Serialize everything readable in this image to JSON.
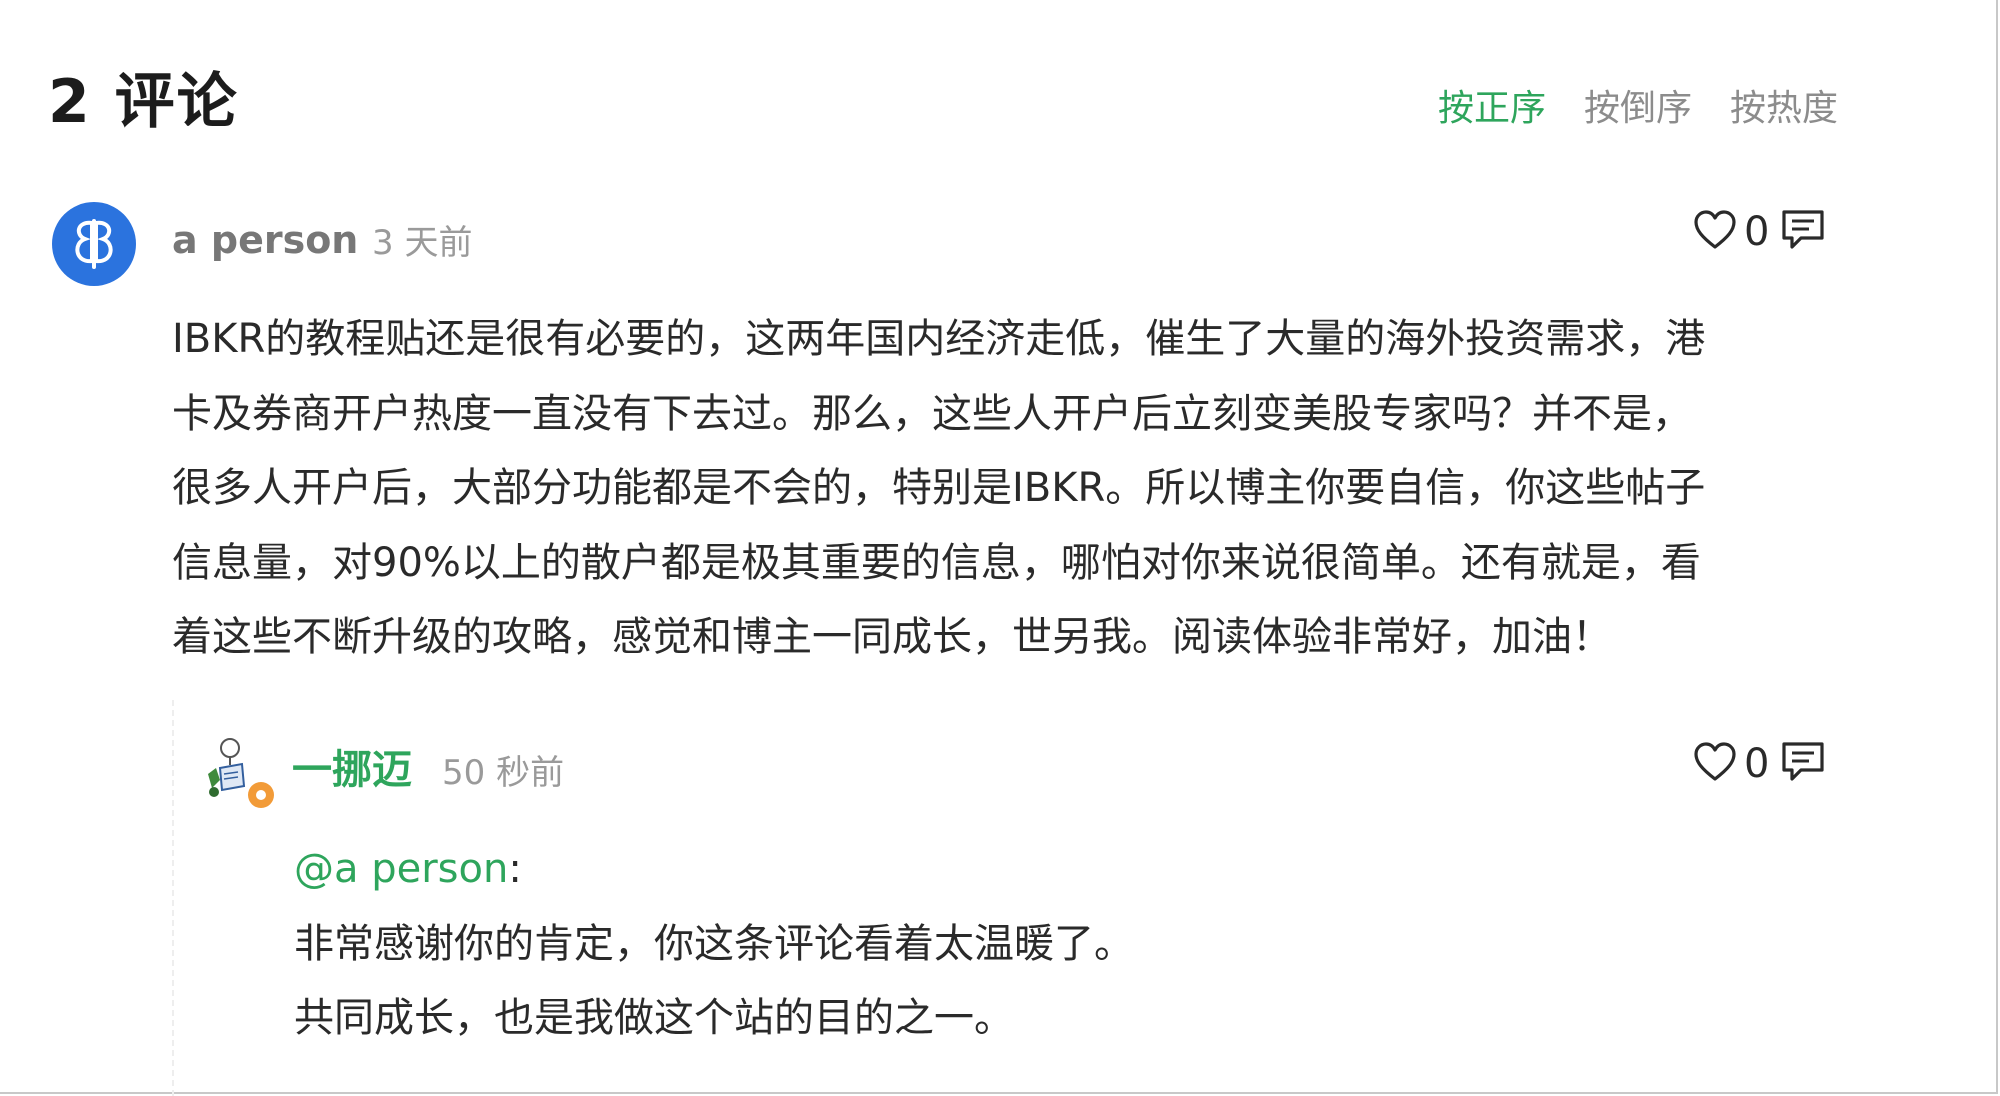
{
  "comments_header": {
    "title": "2 评论",
    "sort_options": [
      "按正序",
      "按倒序",
      "按热度"
    ],
    "active_sort": "按正序"
  },
  "comment": {
    "author": "a person",
    "time": "3 天前",
    "likes": "0",
    "avatar_icon": "butterfly-logo-icon",
    "body_lines": [
      "IBKR的教程贴还是很有必要的，这两年国内经济走低，催生了大量的海外投资需求，港",
      "卡及券商开户热度一直没有下去过。那么，这些人开户后立刻变美股专家吗？并不是，",
      "很多人开户后，大部分功能都是不会的，特别是IBKR。所以博主你要自信，你这些帖子",
      "信息量，对90%以上的散户都是极其重要的信息，哪怕对你来说很简单。还有就是，看",
      "着这些不断升级的攻略，感觉和博主一同成长，世另我。阅读体验非常好，加油！"
    ]
  },
  "reply": {
    "author": "一挪迈",
    "time": "50 秒前",
    "likes": "0",
    "avatar_icon": "reading-figure-avatar-icon",
    "badge_icon": "gear-badge-icon",
    "mention": "@a person",
    "mention_suffix": ":",
    "body_lines": [
      "非常感谢你的肯定，你这条评论看着太温暖了。",
      "共同成长，也是我做这个站的目的之一。"
    ]
  },
  "colors": {
    "accent": "#2ea55c",
    "muted": "#8c8c8c",
    "avatar_blue": "#2b73de",
    "text": "#2a2a2a"
  }
}
